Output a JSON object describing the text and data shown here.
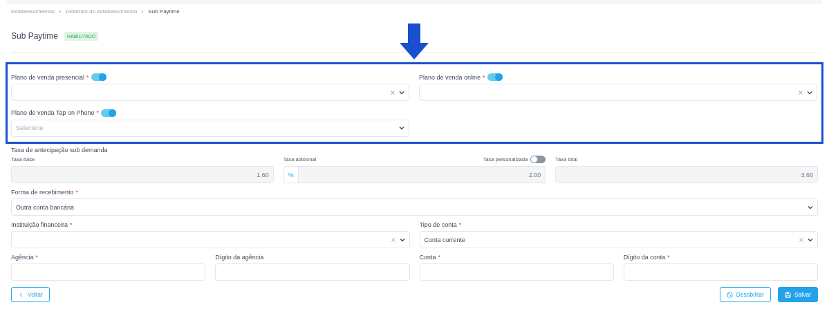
{
  "breadcrumb": [
    {
      "label": "Estabelecimentos",
      "current": false
    },
    {
      "label": "Detalhes do estabelecimento",
      "current": false
    },
    {
      "label": "Sub Paytime",
      "current": true
    }
  ],
  "title": "Sub Paytime",
  "status_badge": "HABILITADO",
  "plan_fields": [
    {
      "label": "Plano de venda presencial",
      "required_mark": "*",
      "enabled": true,
      "clearable": true
    },
    {
      "label": "Plano de venda online",
      "required_mark": "*",
      "enabled": true,
      "clearable": true
    },
    {
      "label": "Plano de venda Tap on Phone",
      "required_mark": "*",
      "enabled": true,
      "clearable": false,
      "placeholder": "Selecione"
    }
  ],
  "anticipation": {
    "title": "Taxa de antecipação sob demanda",
    "base": {
      "label": "Taxa base",
      "value": "1.60",
      "disabled": true
    },
    "additional": {
      "label": "Taxa adicional",
      "prefix": "%",
      "value": "2.00",
      "disabled": true,
      "custom_toggle": {
        "label": "Taxa personalizada",
        "on": false
      }
    },
    "total": {
      "label": "Taxa total",
      "value": "3.60",
      "disabled": true
    }
  },
  "payment_method": {
    "label": "Forma de recebimento",
    "required_mark": "*",
    "value": "Outra conta bancária",
    "clearable": false
  },
  "bank_rows": [
    [
      {
        "kind": "select",
        "label": "Instituição financeira",
        "required_mark": "*",
        "clearable": true
      },
      {
        "kind": "select",
        "label": "Tipo de conta",
        "required_mark": "*",
        "clearable": true,
        "value": "Conta corrente"
      }
    ],
    [
      {
        "kind": "input",
        "label": "Agência",
        "required_mark": "*"
      },
      {
        "kind": "input",
        "label": "Dígito da agência"
      },
      {
        "kind": "input",
        "label": "Conta",
        "required_mark": "*"
      },
      {
        "kind": "input",
        "label": "Dígito da conta",
        "required_mark": "*"
      }
    ]
  ],
  "buttons": [
    {
      "label": "Voltar",
      "kind": "back"
    },
    {
      "label": "Desabilitar",
      "kind": "disable"
    },
    {
      "label": "Salvar",
      "kind": "save"
    }
  ]
}
